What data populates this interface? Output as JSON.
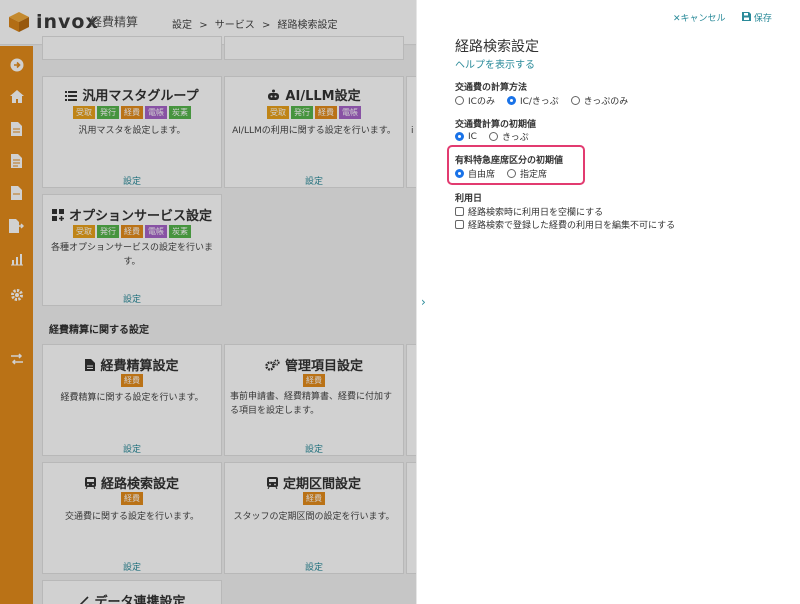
{
  "app": {
    "brand": "invox",
    "brand_sub": "経費精算",
    "breadcrumbs": [
      "設定",
      ">",
      "サービス",
      ">",
      "経路検索設定"
    ]
  },
  "cards": {
    "master_group": {
      "title": "汎用マスタグループ",
      "tags": [
        "受取",
        "発行",
        "経費",
        "電帳",
        "炭素"
      ],
      "desc": "汎用マスタを設定します。",
      "link": "設定"
    },
    "ai_llm": {
      "title": "AI/LLM設定",
      "tags": [
        "受取",
        "発行",
        "経費",
        "電帳"
      ],
      "desc": "AI/LLMの利用に関する設定を行います。",
      "link": "設定"
    },
    "option_service": {
      "title": "オプションサービス設定",
      "tags": [
        "受取",
        "発行",
        "経費",
        "電帳",
        "炭素"
      ],
      "desc": "各種オプションサービスの設定を行います。",
      "link": "設定"
    },
    "expense_settings": {
      "title": "経費精算設定",
      "tags": [
        "経費"
      ],
      "desc": "経費精算に関する設定を行います。",
      "link": "設定"
    },
    "management_items": {
      "title": "管理項目設定",
      "tags": [
        "経費"
      ],
      "desc": "事前申請書、経費精算書、経費に付加する項目を設定します。",
      "link": "設定"
    },
    "route_search": {
      "title": "経路検索設定",
      "tags": [
        "経費"
      ],
      "desc": "交通費に関する設定を行います。",
      "link": "設定"
    },
    "commuter_pass": {
      "title": "定期区間設定",
      "tags": [
        "経費"
      ],
      "desc": "スタッフの定期区間の設定を行います。",
      "link": "設定"
    },
    "data_link": {
      "title": "データ連携設定"
    },
    "partial_right_desc": "i"
  },
  "section_title": "経費精算に関する設定",
  "panel": {
    "cancel_label": "キャンセル",
    "save_label": "保存",
    "title": "経路検索設定",
    "help_link": "ヘルプを表示する",
    "calc_method": {
      "label": "交通費の計算方法",
      "options": [
        "ICのみ",
        "IC/きっぷ",
        "きっぷのみ"
      ],
      "selected": "IC/きっぷ"
    },
    "initial_value": {
      "label": "交通費計算の初期値",
      "options": [
        "IC",
        "きっぷ"
      ],
      "selected": "IC"
    },
    "reserved_seat": {
      "label": "有料特急座席区分の初期値",
      "options": [
        "自由席",
        "指定席"
      ],
      "selected": "自由席"
    },
    "usage_date": {
      "label": "利用日",
      "checkboxes": [
        "経路検索時に利用日を空欄にする",
        "経路検索で登録した経費の利用日を編集不可にする"
      ]
    }
  },
  "colors": {
    "accent": "#2a8a99",
    "sidebar": "#e38b1c",
    "highlight": "#e23b70",
    "radio_selected": "#1a73e8"
  }
}
